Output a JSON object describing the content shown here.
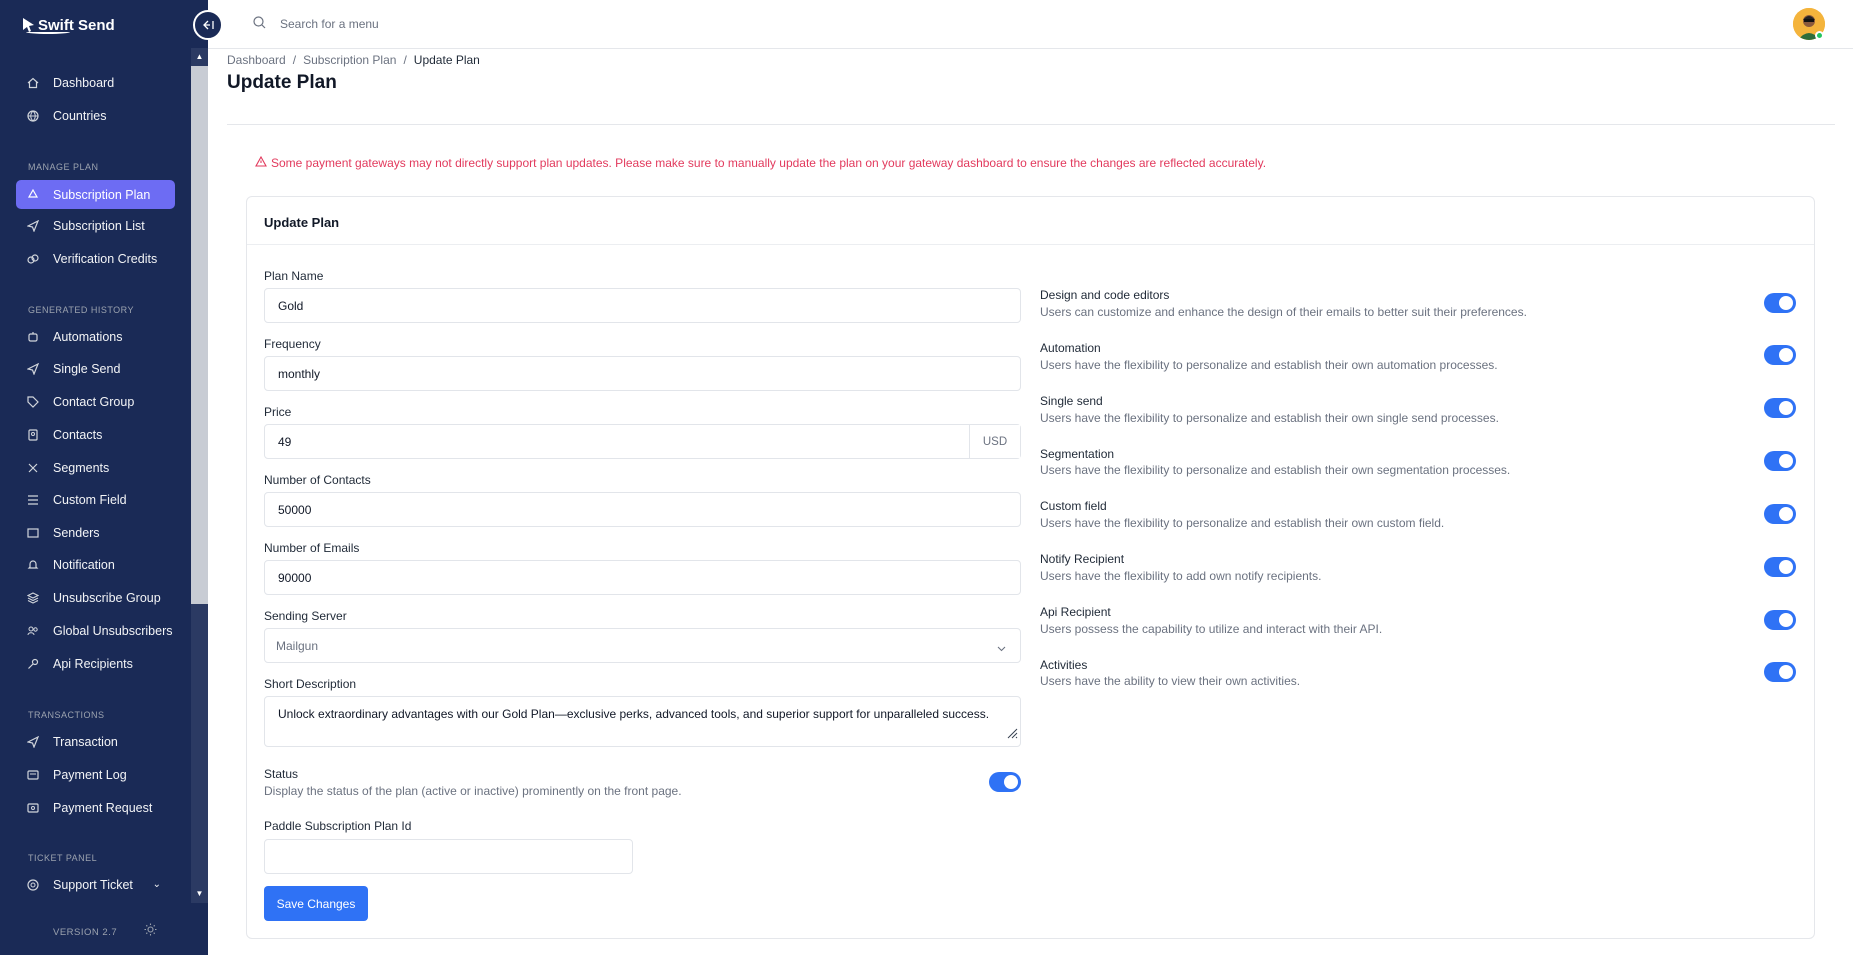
{
  "app": {
    "brand": "Swift Send",
    "version": "VERSION 2.7"
  },
  "topbar": {
    "search_placeholder": "Search for a menu"
  },
  "sidebar": {
    "items": [
      {
        "label": "Dashboard",
        "icon": "home-icon"
      },
      {
        "label": "Countries",
        "icon": "globe-icon"
      }
    ],
    "sections": [
      {
        "title": "MANAGE PLAN",
        "items": [
          {
            "label": "Subscription Plan",
            "icon": "recycle-icon",
            "active": true
          },
          {
            "label": "Subscription List",
            "icon": "send-icon"
          },
          {
            "label": "Verification Credits",
            "icon": "coins-icon"
          }
        ]
      },
      {
        "title": "GENERATED HISTORY",
        "items": [
          {
            "label": "Automations",
            "icon": "robot-icon"
          },
          {
            "label": "Single Send",
            "icon": "send-icon"
          },
          {
            "label": "Contact Group",
            "icon": "tag-icon"
          },
          {
            "label": "Contacts",
            "icon": "contacts-icon"
          },
          {
            "label": "Segments",
            "icon": "segments-icon"
          },
          {
            "label": "Custom Field",
            "icon": "list-icon"
          },
          {
            "label": "Senders",
            "icon": "senders-icon"
          },
          {
            "label": "Notification",
            "icon": "bell-icon"
          },
          {
            "label": "Unsubscribe Group",
            "icon": "stack-icon"
          },
          {
            "label": "Global Unsubscribers",
            "icon": "users-icon"
          },
          {
            "label": "Api Recipients",
            "icon": "key-icon"
          }
        ]
      },
      {
        "title": "TRANSACTIONS",
        "items": [
          {
            "label": "Transaction",
            "icon": "send-icon"
          },
          {
            "label": "Payment Log",
            "icon": "log-icon"
          },
          {
            "label": "Payment Request",
            "icon": "request-icon"
          }
        ]
      },
      {
        "title": "TICKET PANEL",
        "items": [
          {
            "label": "Support Ticket",
            "icon": "support-icon"
          }
        ]
      }
    ]
  },
  "breadcrumb": [
    "Dashboard",
    "Subscription Plan",
    "Update Plan"
  ],
  "page_title": "Update Plan",
  "alert": "Some payment gateways may not directly support plan updates. Please make sure to manually update the plan on your gateway dashboard to ensure the changes are reflected accurately.",
  "form": {
    "card_title": "Update Plan",
    "plan_name": {
      "label": "Plan Name",
      "value": "Gold"
    },
    "frequency": {
      "label": "Frequency",
      "value": "monthly"
    },
    "price": {
      "label": "Price",
      "value": "49",
      "unit": "USD"
    },
    "contacts": {
      "label": "Number of Contacts",
      "value": "50000"
    },
    "emails": {
      "label": "Number of Emails",
      "value": "90000"
    },
    "server": {
      "label": "Sending Server",
      "value": "Mailgun"
    },
    "description": {
      "label": "Short Description",
      "value": "Unlock extraordinary advantages with our Gold Plan—exclusive perks, advanced tools, and superior support for unparalleled success."
    },
    "status": {
      "label": "Status",
      "hint": "Display the status of the plan (active or inactive) prominently on the front page.",
      "on": true
    },
    "paddle": {
      "label": "Paddle Subscription Plan Id",
      "value": ""
    },
    "save_label": "Save Changes"
  },
  "features": [
    {
      "title": "Design and code editors",
      "desc": "Users can customize and enhance the design of their emails to better suit their preferences.",
      "on": true
    },
    {
      "title": "Automation",
      "desc": "Users have the flexibility to personalize and establish their own automation processes.",
      "on": true
    },
    {
      "title": "Single send",
      "desc": "Users have the flexibility to personalize and establish their own single send processes.",
      "on": true
    },
    {
      "title": "Segmentation",
      "desc": "Users have the flexibility to personalize and establish their own segmentation processes.",
      "on": true
    },
    {
      "title": "Custom field",
      "desc": "Users have the flexibility to personalize and establish their own custom field.",
      "on": true
    },
    {
      "title": "Notify Recipient",
      "desc": "Users have the flexibility to add own notify recipients.",
      "on": true
    },
    {
      "title": "Api Recipient",
      "desc": "Users possess the capability to utilize and interact with their API.",
      "on": true
    },
    {
      "title": "Activities",
      "desc": "Users have the ability to view their own activities.",
      "on": true
    }
  ],
  "colors": {
    "sidebar_bg": "#1a2a56",
    "active_item": "#6d6cf3",
    "primary": "#2f72f5",
    "alert": "#e23a5d"
  }
}
